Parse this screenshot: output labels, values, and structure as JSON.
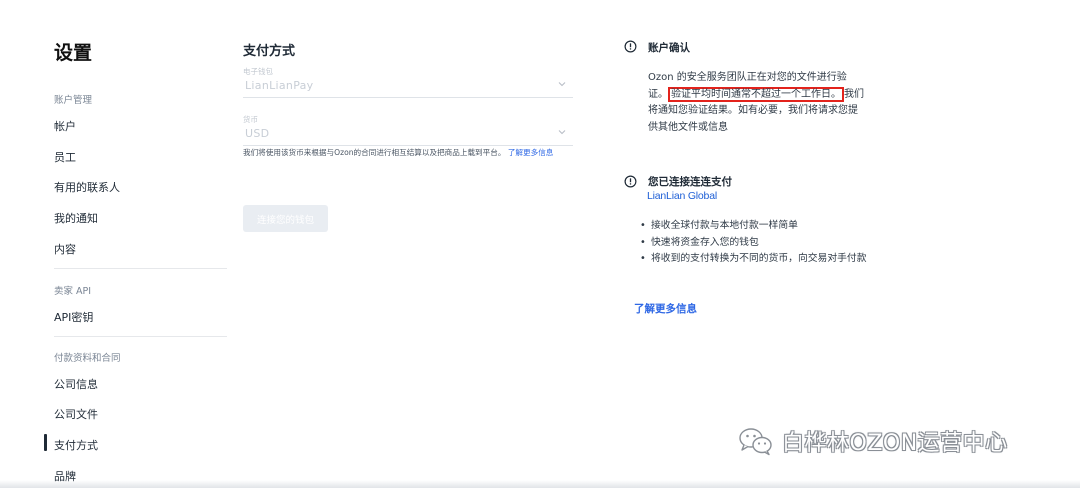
{
  "sidebar": {
    "title": "设置",
    "sections": [
      {
        "label": "账户管理",
        "items": [
          "帐户",
          "员工",
          "有用的联系人",
          "我的通知",
          "内容"
        ]
      },
      {
        "label": "卖家 API",
        "items": [
          "API密钥"
        ]
      },
      {
        "label": "付款资料和合同",
        "items": [
          "公司信息",
          "公司文件",
          "支付方式",
          "品牌"
        ]
      }
    ],
    "active_item": "支付方式"
  },
  "main": {
    "title": "支付方式",
    "wallet_field": {
      "label": "电子钱包",
      "value": "LianLianPay"
    },
    "currency_field": {
      "label": "货币",
      "value": "USD"
    },
    "helper_text": "我们将使用该货币来根据与Ozon的合同进行相互结算以及把商品上载到平台。",
    "helper_link": "了解更多信息",
    "connect_button": "连接您的钱包"
  },
  "account_card": {
    "title": "账户确认",
    "text_before": "Ozon 的安全服务团队正在对您的文件进行验证。",
    "text_highlight": "验证平均时间通常不超过一个工作日。",
    "text_after": "我们将通知您验证结果。如有必要，我们将请求您提供其他文件或信息"
  },
  "lianlian_card": {
    "title": "您已连接连连支付",
    "logo_text": "LianLian Global",
    "bullets": [
      "接收全球付款与本地付款一样简单",
      "快速将资金存入您的钱包",
      "将收到的支付转换为不同的货币，向交易对手付款"
    ],
    "learn_more": "了解更多信息"
  },
  "watermark": {
    "text": "白桦林OZON运营中心"
  },
  "colors": {
    "accent": "#2f68e5",
    "highlight_border": "#e3231c",
    "text": "#1f2a36"
  }
}
